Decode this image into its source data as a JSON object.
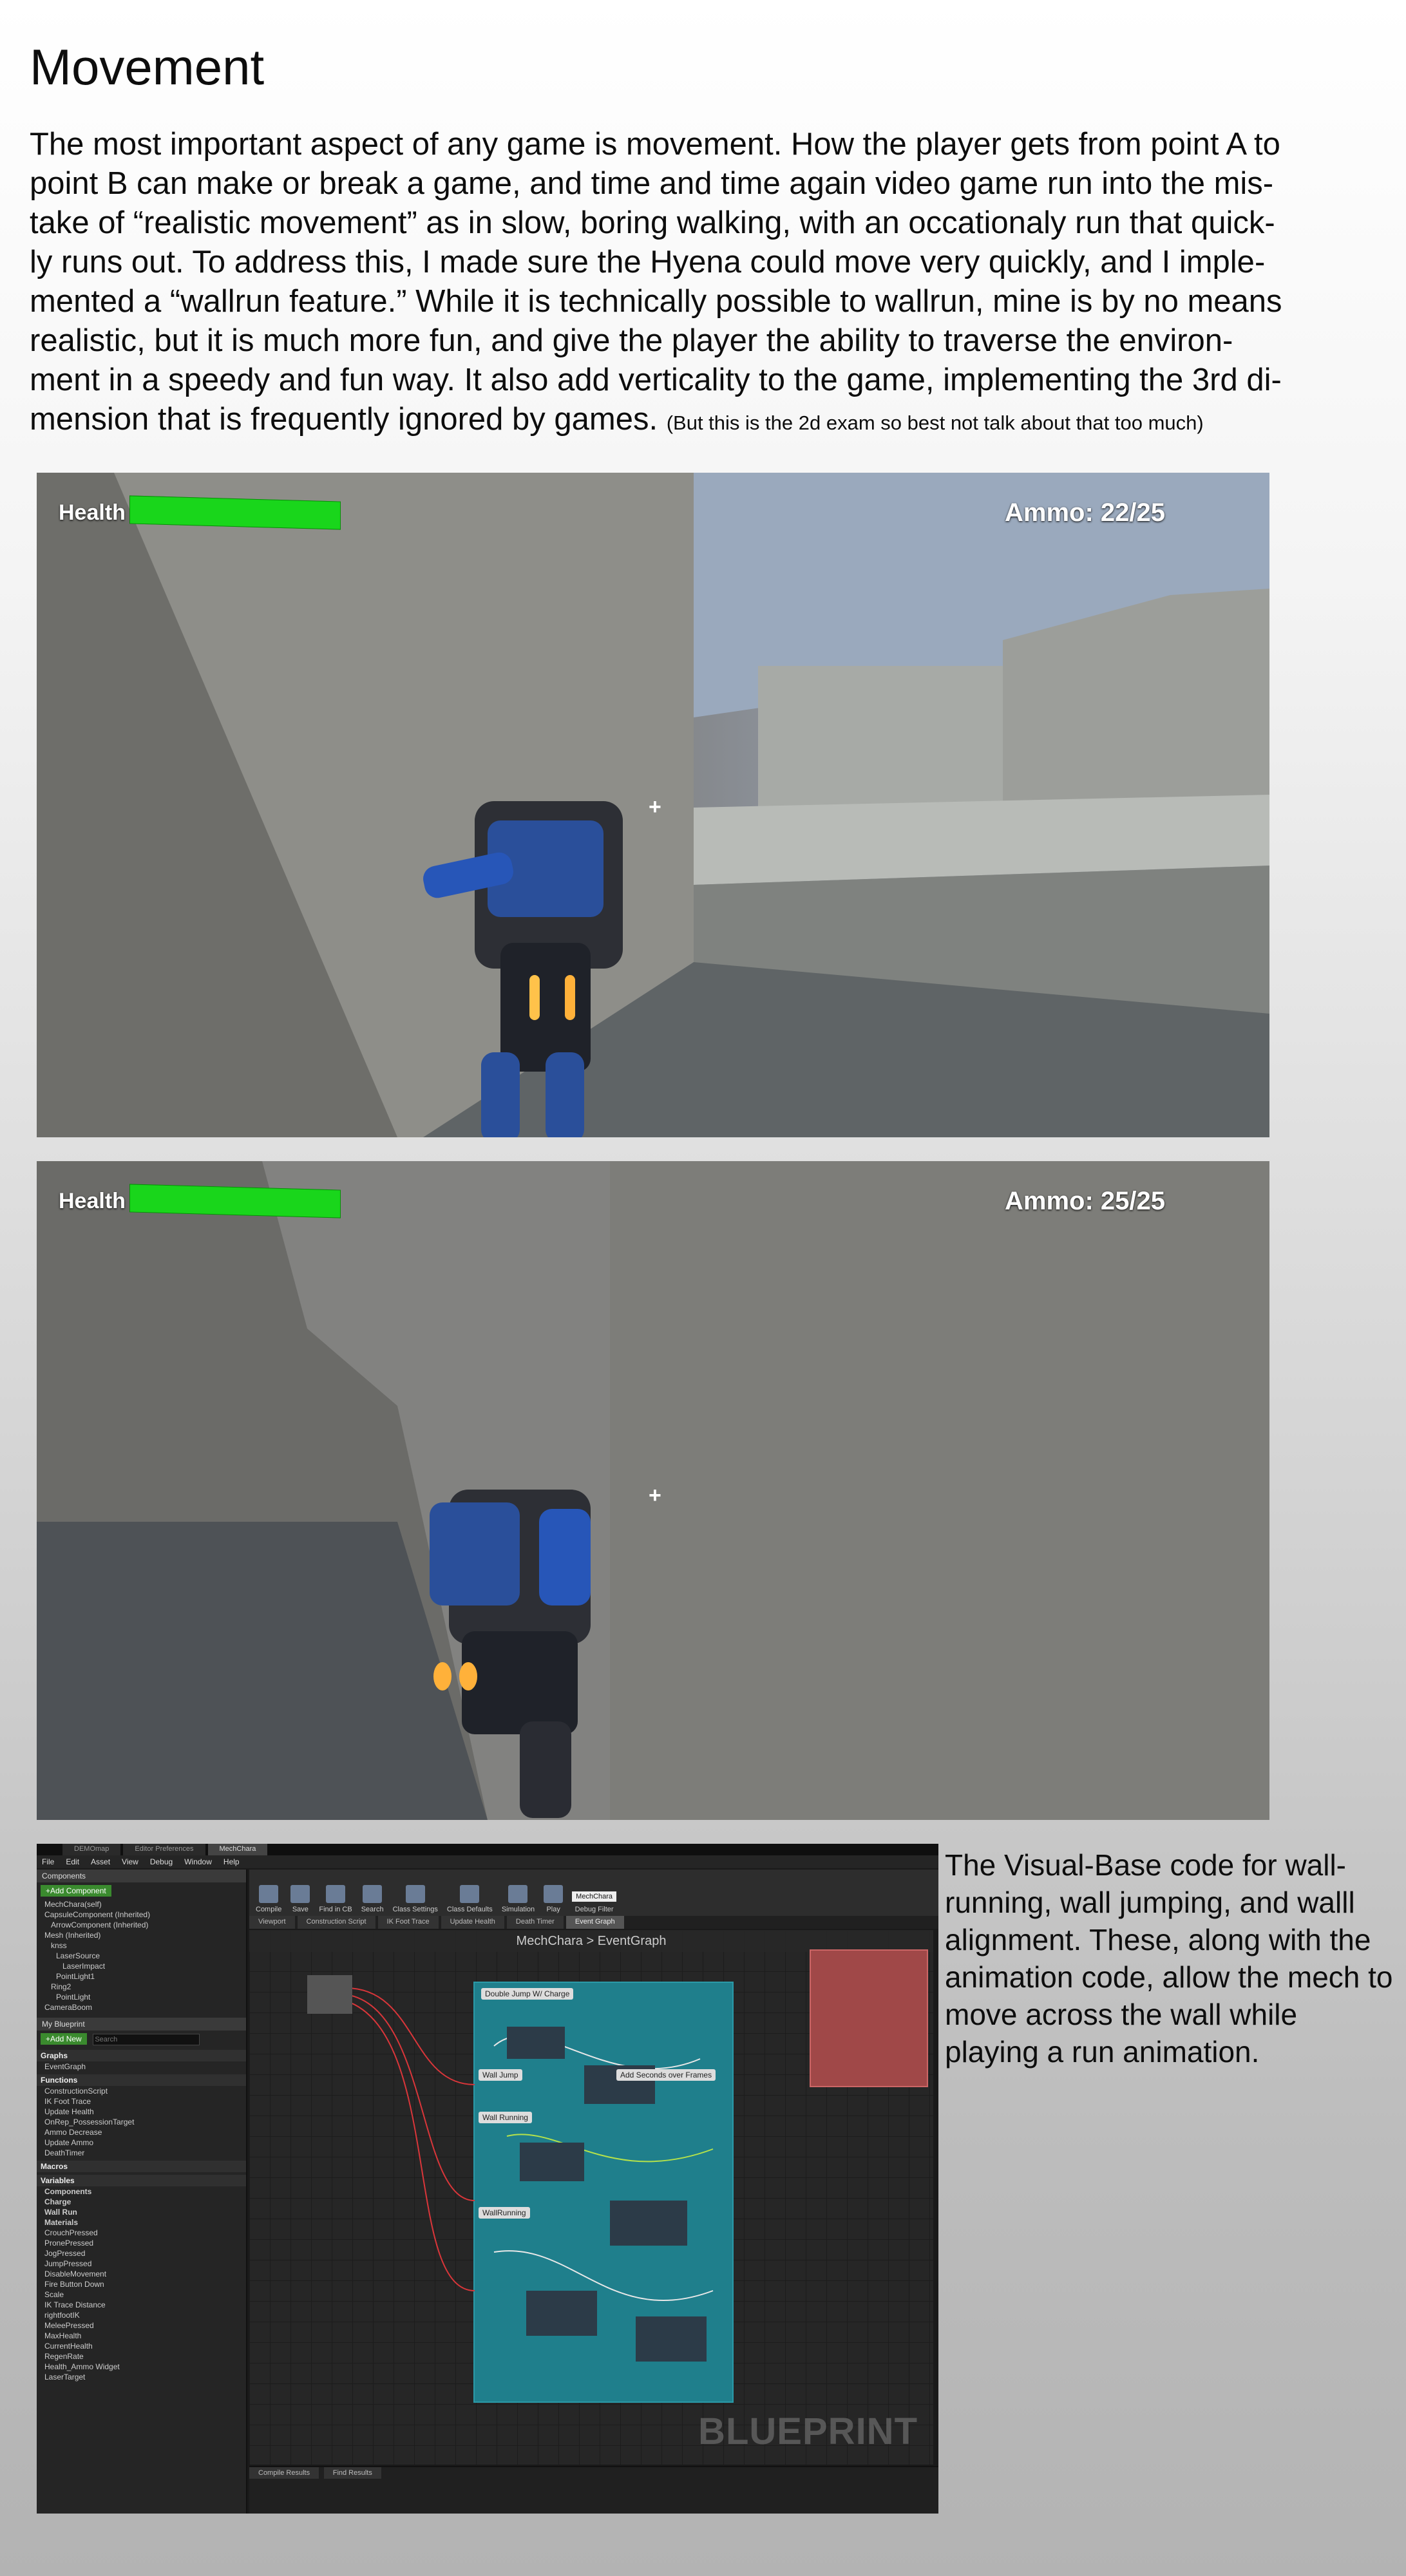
{
  "title": "Movement",
  "intro": {
    "main": "The most important aspect of any game is movement. How the player gets from point A to point B can make or break a game, and time and time again video game run into the mis­take of “realistic movement” as in slow, boring walking, with an occationaly run that quick­ly runs out. To address this, I made sure the Hyena could move very quickly, and I imple­mented a “wallrun feature.” While it is technically possible to wallrun, mine is by no means realistic, but it is much more fun, and give the player the ability to traverse the environ­ment in a speedy and fun way. It also add verticality to the game, implementing the 3rd di­mension that is frequently ignored by games. ",
    "aside": "(But this is the 2d exam so best not talk about that too much)"
  },
  "screenshots": [
    {
      "health_label": "Health",
      "health_fraction": 1.0,
      "ammo": "Ammo: 22/25",
      "crosshair": "+"
    },
    {
      "health_label": "Health",
      "health_fraction": 1.0,
      "ammo": "Ammo: 25/25",
      "crosshair": "+"
    }
  ],
  "editor": {
    "tabs": [
      "DEMOmap",
      "Editor Preferences",
      "MechChara"
    ],
    "menu": [
      "File",
      "Edit",
      "Asset",
      "View",
      "Debug",
      "Window",
      "Help"
    ],
    "components_header": "Components",
    "add_component": "+Add Component",
    "components": [
      "MechChara(self)",
      "CapsuleComponent (Inherited)",
      "ArrowComponent (Inherited)",
      "Mesh (Inherited)",
      "knss",
      "LaserSource",
      "LaserImpact",
      "PointLight1",
      "Ring2",
      "PointLight",
      "CameraBoom"
    ],
    "my_blueprint": "My Blueprint",
    "add_new": "+Add New",
    "search_placeholder": "Search",
    "graphs_header": "Graphs",
    "graphs": [
      "EventGraph"
    ],
    "functions_header": "Functions",
    "functions": [
      "ConstructionScript",
      "IK Foot Trace",
      "Update Health",
      "OnRep_PossessionTarget",
      "Ammo Decrease",
      "Update Ammo",
      "DeathTimer"
    ],
    "macros_header": "Macros",
    "variables_header": "Variables",
    "variables": [
      "Components",
      "Charge",
      "Wall Run",
      "Materials",
      "CrouchPressed",
      "PronePressed",
      "JogPressed",
      "JumpPressed",
      "DisableMovement",
      "Fire Button Down",
      "Scale",
      "IK Trace Distance",
      "rightfootIK",
      "MeleePressed",
      "MaxHealth",
      "CurrentHealth",
      "RegenRate",
      "Health_Ammo Widget",
      "LaserTarget"
    ],
    "toolbar": [
      "Compile",
      "Save",
      "Find in CB",
      "Search",
      "Class Settings",
      "Class Defaults",
      "Simulation",
      "Play"
    ],
    "debug_filter_value": "MechChara",
    "debug_filter_label": "Debug Filter",
    "graph_tabs": [
      "Viewport",
      "Construction Script",
      "IK Foot Trace",
      "Update Health",
      "Death Timer",
      "Event Graph"
    ],
    "breadcrumb": "MechChara > EventGraph",
    "comments": [
      "Double Jump W/ Charge",
      "Add Seconds over Frames",
      "Wall Jump",
      "Wall Running",
      "WallRunning"
    ],
    "watermark": "BLUEPRINT",
    "bottom_tabs": [
      "Compile Results",
      "Find Results"
    ]
  },
  "side_text": "The Visual-Base code for wall-running, wall jumping, and walll alignment. These, along with the animation code, allow the mech to move across the wall while playing a run animation."
}
